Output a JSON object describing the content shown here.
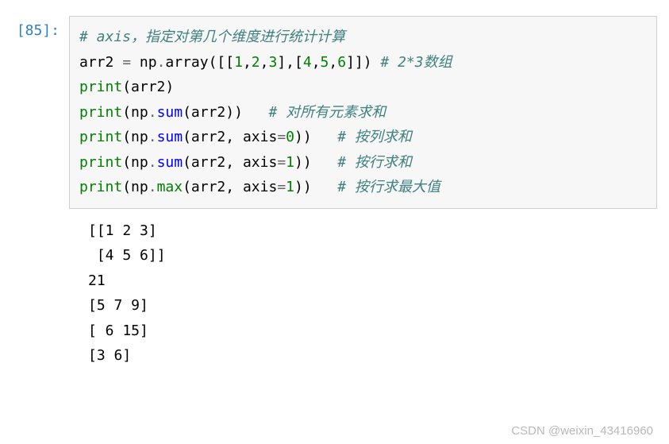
{
  "prompt": "[85]:",
  "code": {
    "line1_comment": "# axis，指定对第几个维度进行统计计算",
    "line2_arr2": "arr2",
    "line2_eq": " = ",
    "line2_np": "np",
    "line2_dot1": ".",
    "line2_array": "array",
    "line2_open": "([[",
    "line2_n1": "1",
    "line2_c1": ",",
    "line2_n2": "2",
    "line2_c2": ",",
    "line2_n3": "3",
    "line2_mid": "],[",
    "line2_n4": "4",
    "line2_c3": ",",
    "line2_n5": "5",
    "line2_c4": ",",
    "line2_n6": "6",
    "line2_close": "]]) ",
    "line2_comment": "# 2*3数组",
    "line3_print": "print",
    "line3_open": "(",
    "line3_arr2": "arr2",
    "line3_close": ")",
    "line4_print": "print",
    "line4_open": "(",
    "line4_np": "np",
    "line4_dot": ".",
    "line4_sum": "sum",
    "line4_open2": "(",
    "line4_arr2": "arr2",
    "line4_close": "))   ",
    "line4_comment": "# 对所有元素求和",
    "line5_print": "print",
    "line5_open": "(",
    "line5_np": "np",
    "line5_dot": ".",
    "line5_sum": "sum",
    "line5_open2": "(",
    "line5_arr2": "arr2",
    "line5_comma": ", ",
    "line5_axis": "axis",
    "line5_eq": "=",
    "line5_val": "0",
    "line5_close": "))   ",
    "line5_comment": "# 按列求和",
    "line6_print": "print",
    "line6_open": "(",
    "line6_np": "np",
    "line6_dot": ".",
    "line6_sum": "sum",
    "line6_open2": "(",
    "line6_arr2": "arr2",
    "line6_comma": ", ",
    "line6_axis": "axis",
    "line6_eq": "=",
    "line6_val": "1",
    "line6_close": "))   ",
    "line6_comment": "# 按行求和",
    "line7_print": "print",
    "line7_open": "(",
    "line7_np": "np",
    "line7_dot": ".",
    "line7_max": "max",
    "line7_open2": "(",
    "line7_arr2": "arr2",
    "line7_comma": ", ",
    "line7_axis": "axis",
    "line7_eq": "=",
    "line7_val": "1",
    "line7_close": "))   ",
    "line7_comment": "# 按行求最大值"
  },
  "output": {
    "line1": "[[1 2 3]",
    "line2": " [4 5 6]]",
    "line3": "21",
    "line4": "[5 7 9]",
    "line5": "[ 6 15]",
    "line6": "[3 6]"
  },
  "watermark": "CSDN @weixin_43416960"
}
